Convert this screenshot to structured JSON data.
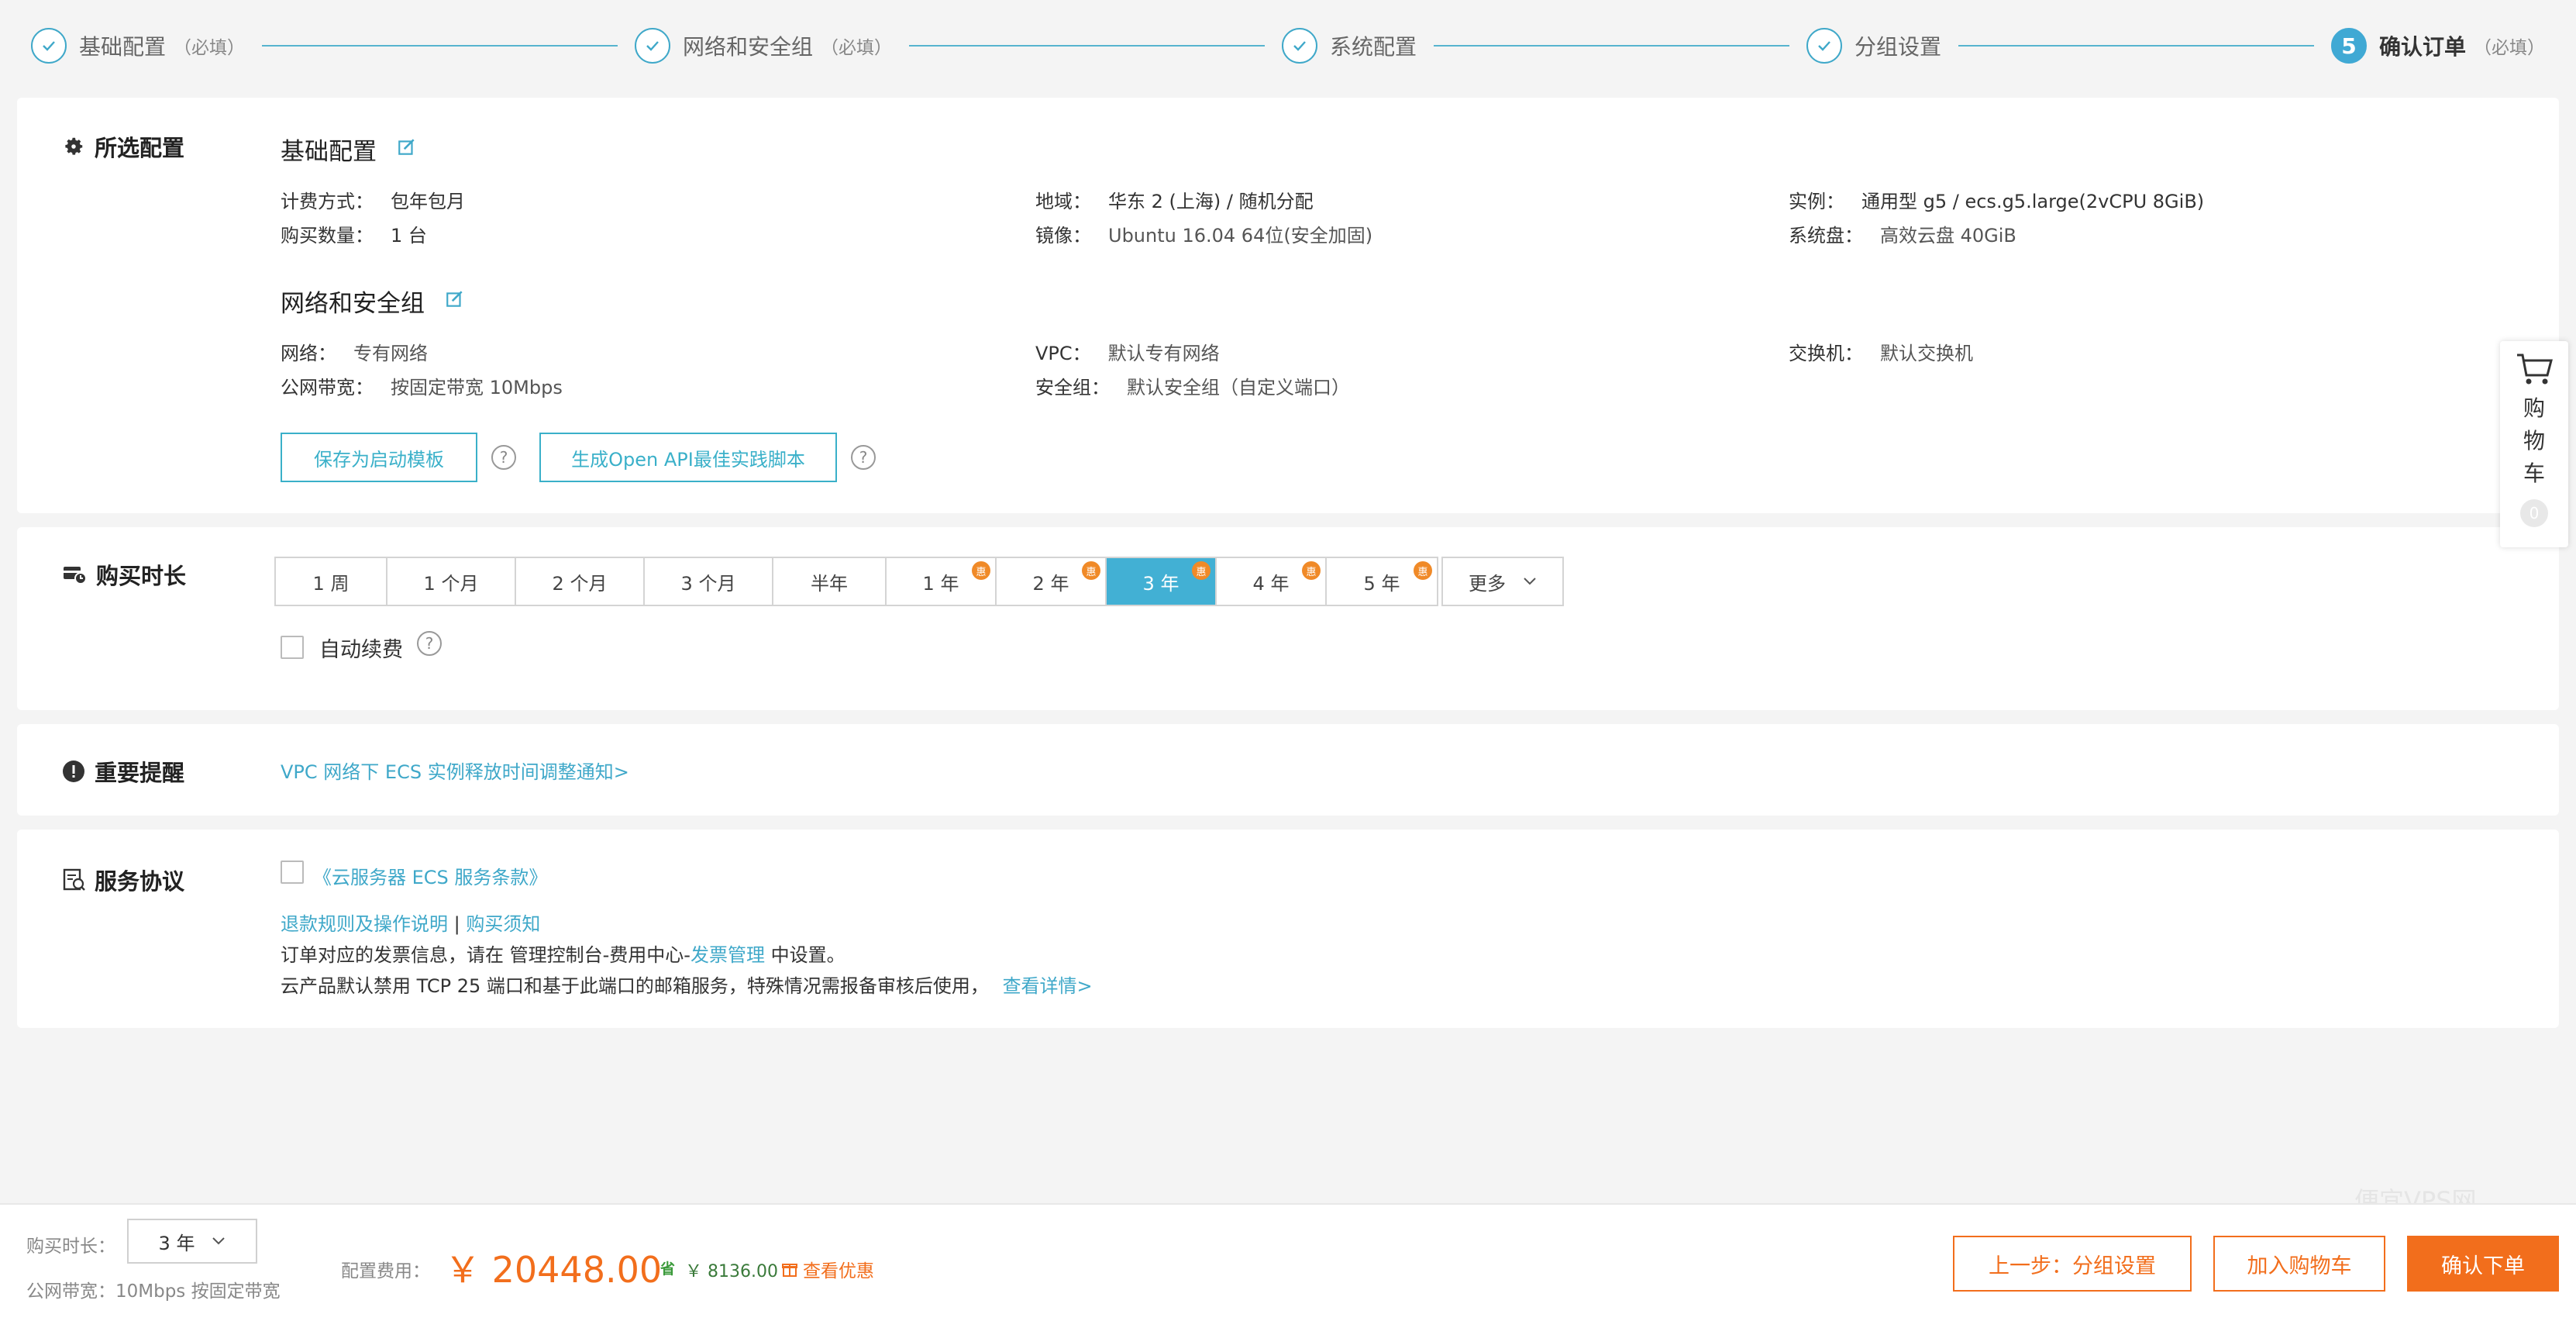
{
  "stepper": {
    "steps": [
      {
        "label": "基础配置",
        "required": "（必填）",
        "status": "done"
      },
      {
        "label": "网络和安全组",
        "required": "（必填）",
        "status": "done"
      },
      {
        "label": "系统配置",
        "required": "",
        "status": "done"
      },
      {
        "label": "分组设置",
        "required": "",
        "status": "done"
      },
      {
        "number": "5",
        "label": "确认订单",
        "required": "（必填）",
        "status": "active"
      }
    ]
  },
  "selected_config": {
    "title": "所选配置",
    "basic": {
      "heading": "基础配置",
      "billing_label": "计费方式：",
      "billing_value": "包年包月",
      "qty_label": "购买数量：",
      "qty_value": "1 台",
      "region_label": "地域：",
      "region_value": "华东 2 (上海) / 随机分配",
      "image_label": "镜像：",
      "image_value": "Ubuntu 16.04 64位(安全加固)",
      "instance_label": "实例：",
      "instance_value": "通用型 g5 / ecs.g5.large(2vCPU 8GiB)",
      "disk_label": "系统盘：",
      "disk_value": "高效云盘 40GiB"
    },
    "network": {
      "heading": "网络和安全组",
      "net_label": "网络：",
      "net_value": "专有网络",
      "bw_label": "公网带宽：",
      "bw_value": "按固定带宽 10Mbps",
      "vpc_label": "VPC：",
      "vpc_value": "默认专有网络",
      "sg_label": "安全组：",
      "sg_value": "默认安全组（自定义端口）",
      "switch_label": "交换机：",
      "switch_value": "默认交换机"
    },
    "save_template_button": "保存为启动模板",
    "openapi_button": "生成Open API最佳实践脚本"
  },
  "duration": {
    "title": "购买时长",
    "options": [
      {
        "label": "1 周",
        "discount": false
      },
      {
        "label": "1 个月",
        "discount": false
      },
      {
        "label": "2 个月",
        "discount": false
      },
      {
        "label": "3 个月",
        "discount": false
      },
      {
        "label": "半年",
        "discount": false
      },
      {
        "label": "1 年",
        "discount": true
      },
      {
        "label": "2 年",
        "discount": true
      },
      {
        "label": "3 年",
        "discount": true
      },
      {
        "label": "4 年",
        "discount": true
      },
      {
        "label": "5 年",
        "discount": true
      }
    ],
    "selected": "3 年",
    "discount_badge": "惠",
    "more_label": "更多",
    "auto_renew_label": "自动续费",
    "auto_renew_checked": false
  },
  "notice": {
    "title": "重要提醒",
    "link": "VPC 网络下 ECS 实例释放时间调整通知>"
  },
  "agreement": {
    "title": "服务协议",
    "terms_link": "《云服务器 ECS 服务条款》",
    "refund_link": "退款规则及操作说明",
    "separator": "|",
    "purchase_link": "购买须知",
    "invoice_prefix": "订单对应的发票信息，请在 管理控制台-费用中心-",
    "invoice_link": "发票管理",
    "invoice_suffix": " 中设置。",
    "tcp_text": "云产品默认禁用 TCP 25 端口和基于此端口的邮箱服务，特殊情况需报备审核后使用，",
    "tcp_link": "查看详情>"
  },
  "cart": {
    "label": "购物车",
    "count": "0"
  },
  "footer": {
    "duration_label": "购买时长：",
    "duration_value": "3 年",
    "bandwidth_text": "公网带宽：10Mbps 按固定带宽",
    "fee_label": "配置费用：",
    "price": "￥ 20448.00",
    "save_icon": "省",
    "save_amount": "￥ 8136.00",
    "discount_link": "查看优惠",
    "prev_button": "上一步：分组设置",
    "add_cart_button": "加入购物车",
    "confirm_button": "确认下单",
    "watermark": "便宜VPS网"
  },
  "colors": {
    "accent": "#3fa8c9",
    "selected": "#42b0d4",
    "orange": "#f26e1c",
    "badge": "#f08a28"
  }
}
